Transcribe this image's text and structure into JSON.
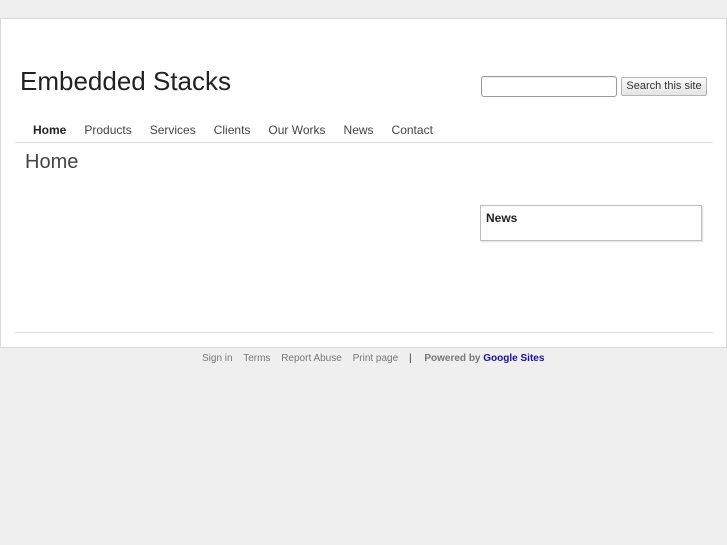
{
  "site": {
    "title": "Embedded Stacks"
  },
  "search": {
    "value": "",
    "button_label": "Search this site"
  },
  "nav": {
    "items": [
      "Home",
      "Products",
      "Services",
      "Clients",
      "Our Works",
      "News",
      "Contact"
    ],
    "active": "Home"
  },
  "main": {
    "heading": "Home"
  },
  "sidebar": {
    "news_title": "News"
  },
  "footer": {
    "sign_in": "Sign in",
    "terms": "Terms",
    "report_abuse": "Report Abuse",
    "print_page": "Print page",
    "separator": "|",
    "powered_by": "Powered by",
    "brand": "Google Sites"
  }
}
